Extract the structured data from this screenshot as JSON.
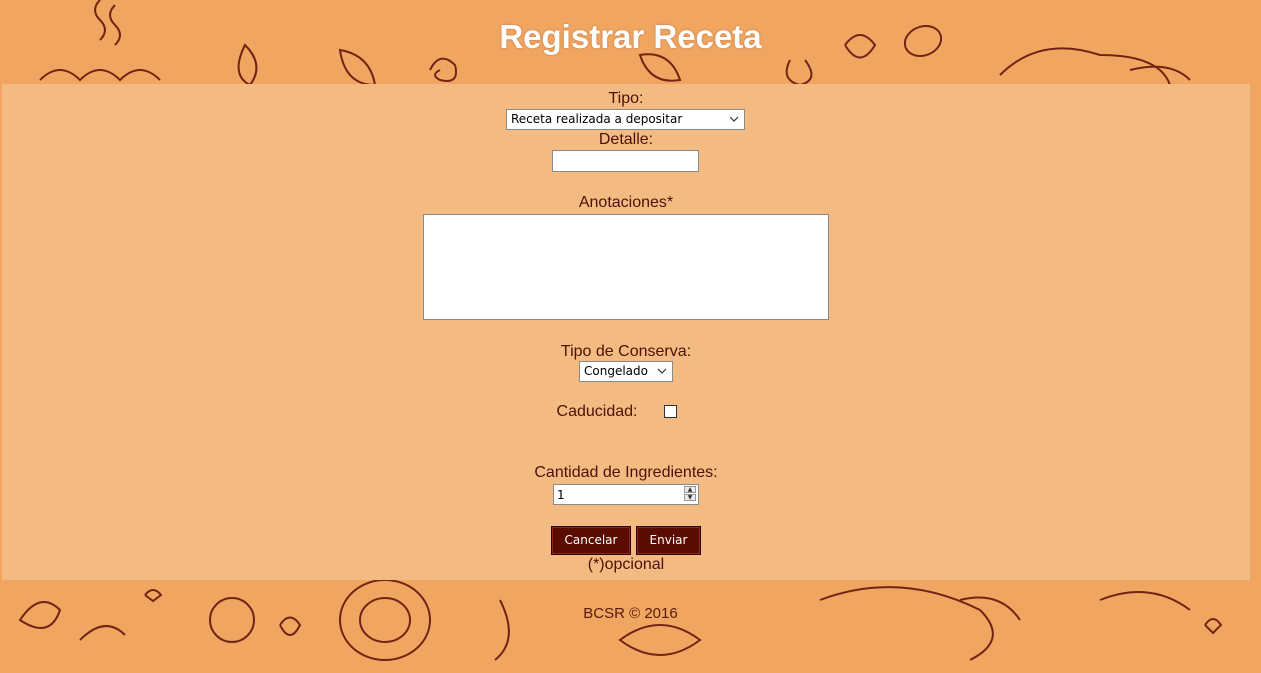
{
  "page": {
    "title": "Registrar Receta"
  },
  "form": {
    "tipo": {
      "label": "Tipo:",
      "selected": "Receta realizada a depositar"
    },
    "detalle": {
      "label": "Detalle:",
      "value": ""
    },
    "anotaciones": {
      "label": "Anotaciones*",
      "value": ""
    },
    "tipo_conserva": {
      "label": "Tipo de Conserva:",
      "selected": "Congelado"
    },
    "caducidad": {
      "label": "Caducidad:",
      "checked": false
    },
    "cantidad_ingredientes": {
      "label": "Cantidad de Ingredientes:",
      "value": "1"
    },
    "buttons": {
      "cancel": "Cancelar",
      "submit": "Enviar"
    },
    "note": "(*)opcional"
  },
  "footer": {
    "text": "BCSR © 2016"
  },
  "colors": {
    "background": "#f0a561",
    "panel": "#f3bb82",
    "text": "#4a1208",
    "button": "#5a0c00",
    "title": "#ffffff"
  }
}
